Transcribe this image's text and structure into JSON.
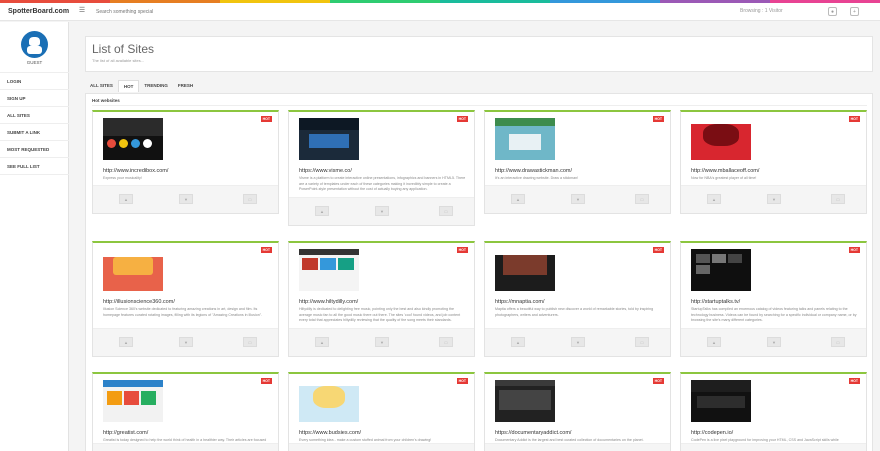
{
  "colors": {
    "rainbow": [
      "#e74c3c",
      "#e67e22",
      "#f1c40f",
      "#2ecc71",
      "#1abc9c",
      "#3498db",
      "#9b59b6",
      "#e84393"
    ],
    "accent_green": "#8cc63f",
    "hot_red": "#e53935",
    "avatar_blue": "#1a6fb5"
  },
  "topbar": {
    "brand": "SpotterBoard.com",
    "menu_icon": "hamburger-icon",
    "search_placeholder": "Search something special",
    "browsing_text": "Browsing : 1 Visitor"
  },
  "sidebar": {
    "user_label": "GUEST",
    "items": [
      {
        "label": "LOGIN"
      },
      {
        "label": "SIGN UP"
      },
      {
        "label": "ALL SITES"
      },
      {
        "label": "SUBMIT A LINK"
      },
      {
        "label": "MOST REQUESTED"
      },
      {
        "label": "SEE FULL LIST"
      }
    ]
  },
  "page": {
    "title": "List of Sites",
    "subtitle": "The list of all available sites..."
  },
  "tabs": [
    {
      "label": "ALL SITES",
      "active": false
    },
    {
      "label": "HOT",
      "active": true
    },
    {
      "label": "TRENDING",
      "active": false
    },
    {
      "label": "FRESH",
      "active": false
    }
  ],
  "section": {
    "label": "Hot websites"
  },
  "badge_label": "HOT",
  "cards": [
    {
      "url": "http://www.incredibox.com/",
      "desc": "Express your musicality!"
    },
    {
      "url": "https://www.visme.co/",
      "desc": "Visme is a platform to create interactive online presentations, infographics and banners in HTML5. There are a variety of templates under each of these categories making it incredibly simple to create a PowerPoint-style presentation without the cost of actually buying any application."
    },
    {
      "url": "http://www.drawastickman.com/",
      "desc": "It's an interactive drawing website. Draw a stickman!"
    },
    {
      "url": "http://www.mballaceoff.com/",
      "desc": "Now for NBA's greatest player of all time!"
    },
    {
      "url": "http://illusionscience360.com/",
      "desc": "Illusion Science 360's website dedicated to featuring amazing creations in art, design and film. Its homepage features curated rotating images, filling with its legions of \"Amazing Creations in Illusion\"."
    },
    {
      "url": "http://www.hiltydilly.com/",
      "desc": "Hiltydilly is dedicated to delighting free music, pointing only the best and also kindly promoting the average music fan to all the good music there out there. The sites 'cool' found videos, and job content every total that appreciates hiltydilly reviewing that the quality of the song meets their standards."
    },
    {
      "url": "https://mnaptia.com/",
      "desc": "Maptia offers a beautiful way to publish new discover a world of remarkable stories, told by inspiring photographers, writers and adventurers."
    },
    {
      "url": "http://startuptalks.tv/",
      "desc": "StartupTalks has compiled an enormous catalog of videos featuring talks and panels relating to the technology business. Videos can be found by searching for a specific individual or company name, or by browsing the site's many different categories."
    },
    {
      "url": "http://greatist.com/",
      "desc": "Greatist is today designed to help the world think of health in a healthier way. Their articles are focused on helping everyday people that you can actually count on your own terms."
    },
    {
      "url": "https://www.budsies.com/",
      "desc": "Every something idea - make a custom stuffed animal from your children's drawing!"
    },
    {
      "url": "https://documentaryaddict.com/",
      "desc": "Documentary Addict is the largest and best curated collection of documentaries on the planet."
    },
    {
      "url": "http://codepen.io/",
      "desc": "CodePen is a live pixel playground for improving your HTML, CSS and JavaScript skills while collaborating and sharing your work with others."
    }
  ]
}
